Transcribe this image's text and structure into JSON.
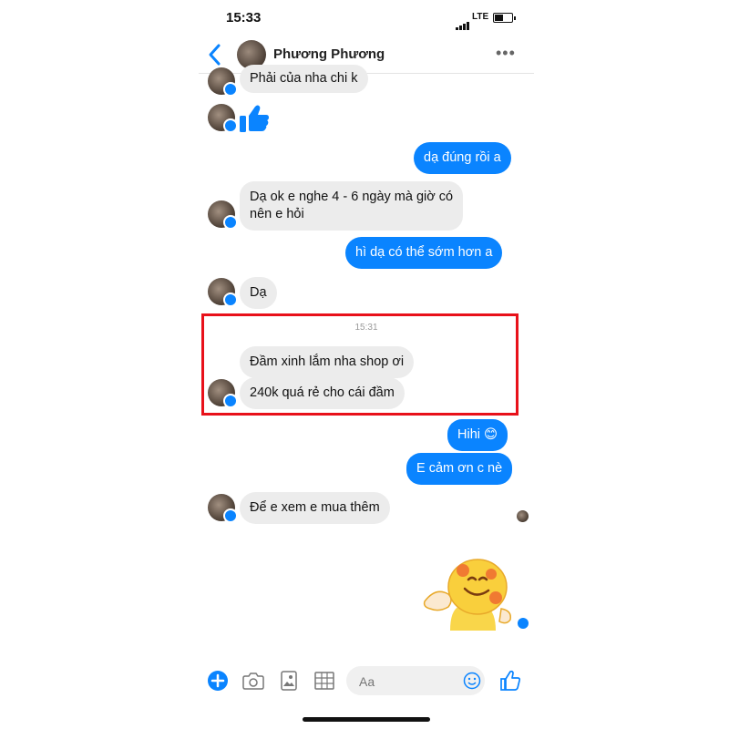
{
  "status_bar": {
    "time": "15:33",
    "network": "LTE"
  },
  "header": {
    "contact_name": "Phương Phương",
    "more_label": "•••"
  },
  "messages": [
    {
      "direction": "in",
      "text": "Phải của nha chi k"
    },
    {
      "direction": "in",
      "type": "like-sticker"
    },
    {
      "direction": "out",
      "text": "dạ đúng rồi a"
    },
    {
      "direction": "in",
      "line1": "Dạ ok e nghe 4 - 6 ngày mà giờ có",
      "line2": "nên e hỏi"
    },
    {
      "direction": "out",
      "text": "hì dạ có thể  sớm hơn a"
    },
    {
      "direction": "in",
      "text": "Dạ"
    },
    {
      "type": "timestamp",
      "text": "15:31"
    },
    {
      "direction": "in",
      "text": "Đầm xinh lắm nha shop ơi"
    },
    {
      "direction": "in",
      "text": "240k quá rẻ cho cái đầm"
    },
    {
      "direction": "out",
      "text": "Hihi",
      "emoji": "😊"
    },
    {
      "direction": "out",
      "text": "E cảm ơn c nè"
    },
    {
      "direction": "in",
      "text": "Để e xem e mua thêm"
    },
    {
      "direction": "out",
      "type": "sticker",
      "sticker": "yellow-cartoon-blowing-kiss"
    }
  ],
  "composer": {
    "placeholder": "Aa"
  },
  "colors": {
    "accent": "#0a84ff",
    "incoming_bubble": "#ececec",
    "highlight": "#e8111a"
  },
  "icons": [
    "back-icon",
    "more-icon",
    "plus-icon",
    "camera-icon",
    "gallery-icon",
    "grid-icon",
    "emoji-icon",
    "like-icon"
  ]
}
